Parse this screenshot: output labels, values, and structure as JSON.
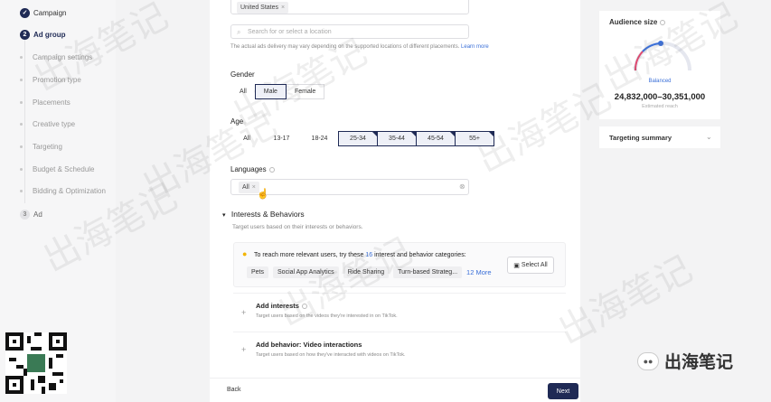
{
  "sidebar": {
    "steps": [
      {
        "label": "Campaign",
        "badge": "✓",
        "state": "done"
      },
      {
        "label": "Ad group",
        "badge": "2",
        "state": "current"
      },
      {
        "label": "Ad",
        "badge": "3",
        "state": "todo"
      }
    ],
    "substeps": [
      "Campaign settings",
      "Promotion type",
      "Placements",
      "Creative type",
      "Targeting",
      "Budget & Schedule",
      "Bidding & Optimization"
    ]
  },
  "location": {
    "chip": "United States",
    "search_placeholder": "Search for or select a location",
    "note": "The actual ads delivery may vary depending on the supported locations of different placements.",
    "learn_more": "Learn more"
  },
  "gender": {
    "label": "Gender",
    "options": [
      "All",
      "Male",
      "Female"
    ],
    "selected": "Male"
  },
  "age": {
    "label": "Age",
    "options": [
      "All",
      "13-17",
      "18-24",
      "25-34",
      "35-44",
      "45-54",
      "55+"
    ],
    "selected": [
      "25-34",
      "35-44",
      "45-54",
      "55+"
    ]
  },
  "languages": {
    "label": "Languages",
    "chip": "All"
  },
  "interests": {
    "title": "Interests & Behaviors",
    "subtitle": "Target users based on their interests or behaviors.",
    "suggest_prefix": "To reach more relevant users, try these ",
    "suggest_count": "16",
    "suggest_suffix": " interest and behavior categories:",
    "tags": [
      "Pets",
      "Social App Analytics",
      "Ride Sharing",
      "Turn-based Strateg..."
    ],
    "more": "12 More",
    "select_all": "Select All",
    "add_interests": "Add interests",
    "add_interests_desc": "Target users based on the videos they're interested in on TikTok.",
    "add_behavior": "Add behavior: Video interactions",
    "add_behavior_desc": "Target users based on how they've interacted with videos on TikTok."
  },
  "footer": {
    "back": "Back",
    "next": "Next"
  },
  "audience": {
    "title": "Audience size",
    "status": "Balanced",
    "range": "24,832,000–30,351,000",
    "caption": "Estimated reach"
  },
  "summary": {
    "title": "Targeting summary"
  },
  "watermark": {
    "text": "出海笔记",
    "logo_text": "出海笔记"
  },
  "colors": {
    "primary": "#1f2a55",
    "link": "#3a6fd8",
    "gauge": "#3a6fd8",
    "gauge_accent": "#e0476e"
  }
}
